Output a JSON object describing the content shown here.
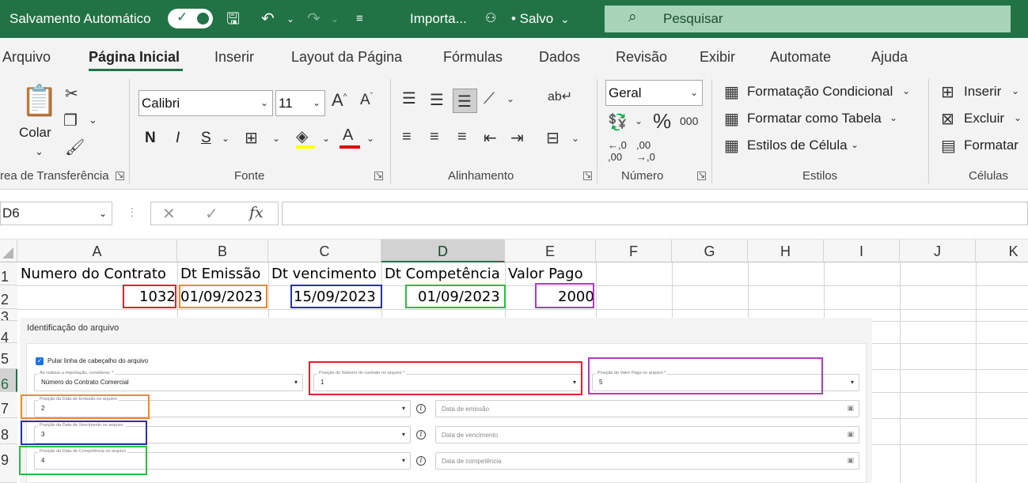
{
  "titlebar": {
    "autosave_label": "Salvamento Automático",
    "doc_name": "Importa...",
    "status": "• Salvo",
    "search_placeholder": "Pesquisar"
  },
  "tabs": [
    "Arquivo",
    "Página Inicial",
    "Inserir",
    "Layout da Página",
    "Fórmulas",
    "Dados",
    "Revisão",
    "Exibir",
    "Automate",
    "Ajuda"
  ],
  "ribbon": {
    "clipboard": {
      "paste_label": "Colar",
      "group_label": "rea de Transferência"
    },
    "font": {
      "font_name": "Calibri",
      "font_size": "11",
      "bold": "N",
      "italic": "I",
      "underline": "S",
      "group_label": "Fonte"
    },
    "alignment": {
      "group_label": "Alinhamento"
    },
    "number": {
      "format": "Geral",
      "group_label": "Número"
    },
    "styles": {
      "conditional": "Formatação Condicional",
      "as_table": "Formatar como Tabela",
      "cell_styles": "Estilos de Célula",
      "group_label": "Estilos"
    },
    "cells": {
      "insert": "Inserir",
      "delete": "Excluir",
      "format": "Formatar",
      "group_label": "Células"
    }
  },
  "formula_bar": {
    "name_box": "D6",
    "fx": "fx",
    "value": ""
  },
  "grid": {
    "columns": [
      "A",
      "B",
      "C",
      "D",
      "E",
      "F",
      "G",
      "H",
      "I",
      "J",
      "K"
    ],
    "rows": [
      "1",
      "2",
      "3",
      "4",
      "5",
      "6",
      "7",
      "8",
      "9"
    ],
    "row1": [
      "Numero do Contrato",
      "Dt Emissão",
      "Dt vencimento",
      "Dt Competência",
      "Valor Pago"
    ],
    "row2": [
      "1032",
      "01/09/2023",
      "15/09/2023",
      "01/09/2023",
      "2000"
    ]
  },
  "form": {
    "title": "Identificação do arquivo",
    "skip_header_label": "Pular linha de cabeçalho do arquivo",
    "consider_label": "Ao realizar a importação, considerar: *",
    "consider_value": "Número do Contrato Comercial",
    "contract_pos_label": "Posição do Número do contrato no arquivo *",
    "contract_pos_value": "1",
    "paid_pos_label": "Posição do Valor Pago no arquivo *",
    "paid_pos_value": "5",
    "issue_pos_label": "Posição da Data de Emissão no arquivo",
    "issue_pos_value": "2",
    "issue_date_placeholder": "Data de emissão",
    "due_pos_label": "Posição da Data de Vencimento no arquivo",
    "due_pos_value": "3",
    "due_date_placeholder": "Data de vencimento",
    "comp_pos_label": "Posição da Data de Competência no arquivo",
    "comp_pos_value": "4",
    "comp_date_placeholder": "Data de competência"
  },
  "colors": {
    "excel_green": "#217346",
    "red": "#e0202f",
    "orange": "#f08a24",
    "blue": "#2b2fb3",
    "green": "#22c23a",
    "purple": "#b03ac4"
  }
}
